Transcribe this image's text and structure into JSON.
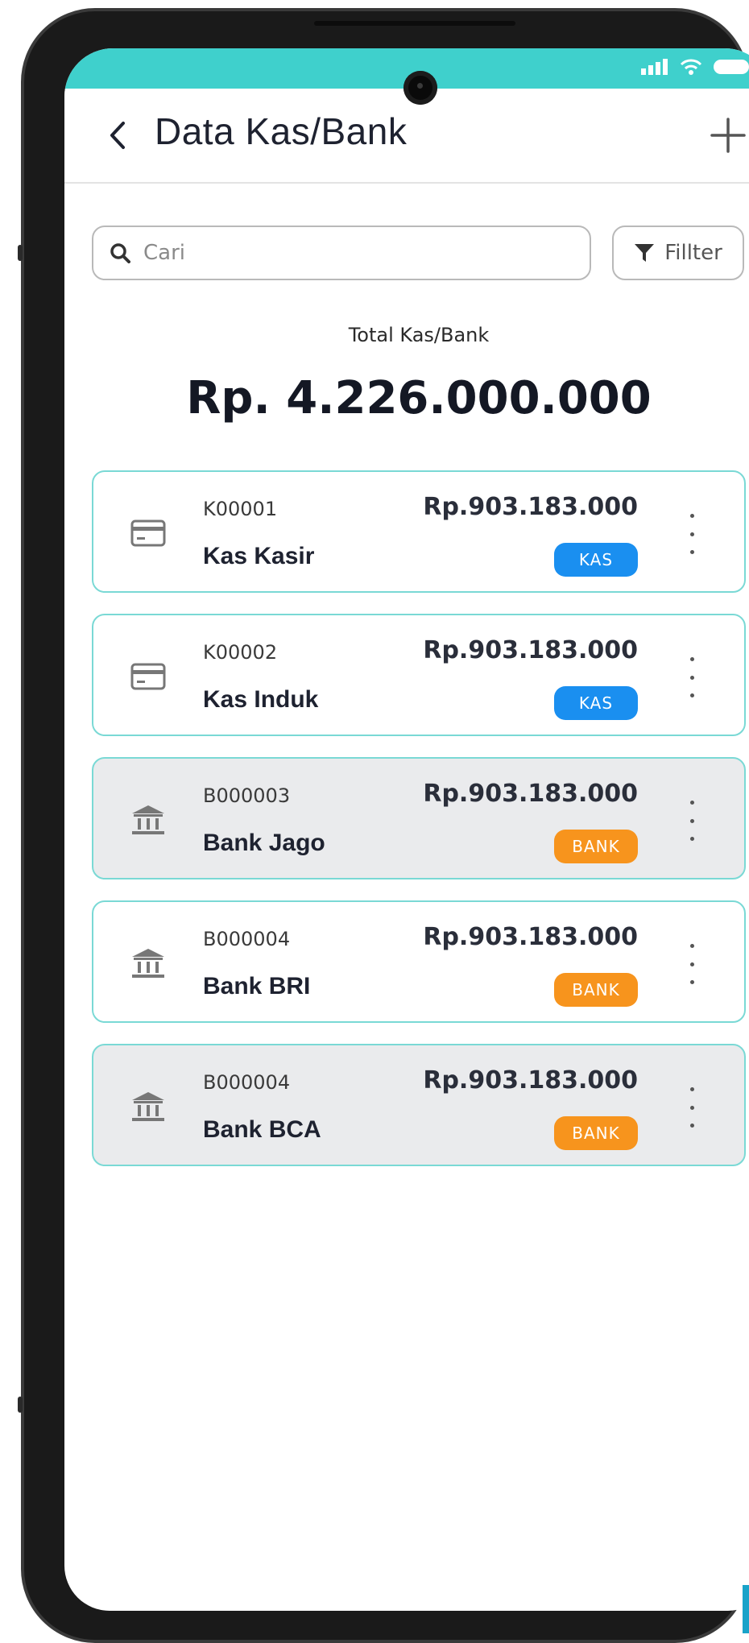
{
  "header": {
    "title": "Data Kas/Bank"
  },
  "search": {
    "placeholder": "Cari"
  },
  "filter": {
    "label": "Fillter"
  },
  "summary": {
    "label": "Total Kas/Bank",
    "value": "Rp. 4.226.000.000"
  },
  "colors": {
    "accent": "#3fd0cc",
    "kas_badge": "#1a8ff0",
    "bank_badge": "#f7941d",
    "card_border": "#7ad9d5"
  },
  "accounts": [
    {
      "code": "K00001",
      "name": "Kas Kasir",
      "amount": "Rp.903.183.000",
      "type": "KAS",
      "icon": "card-icon"
    },
    {
      "code": "K00002",
      "name": "Kas Induk",
      "amount": "Rp.903.183.000",
      "type": "KAS",
      "icon": "card-icon"
    },
    {
      "code": "B000003",
      "name": "Bank Jago",
      "amount": "Rp.903.183.000",
      "type": "BANK",
      "icon": "bank-icon"
    },
    {
      "code": "B000004",
      "name": "Bank BRI",
      "amount": "Rp.903.183.000",
      "type": "BANK",
      "icon": "bank-icon"
    },
    {
      "code": "B000004",
      "name": "Bank BCA",
      "amount": "Rp.903.183.000",
      "type": "BANK",
      "icon": "bank-icon"
    }
  ]
}
